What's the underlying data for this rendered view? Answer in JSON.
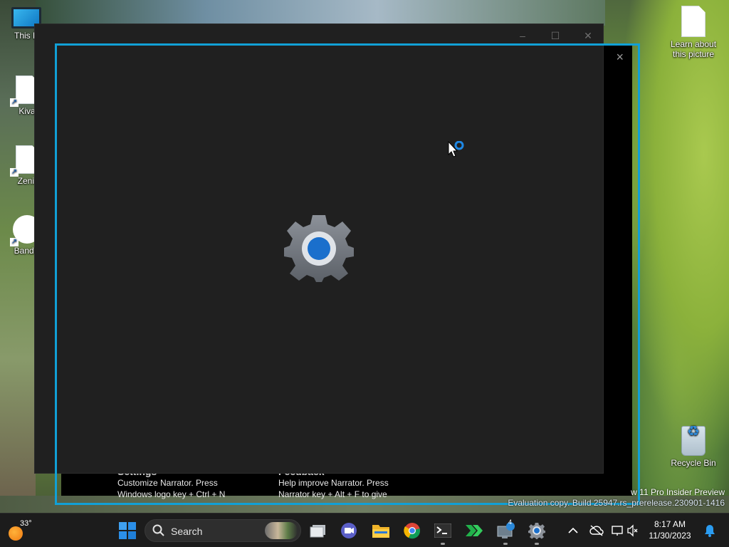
{
  "desktop": {
    "icons": [
      {
        "label": "This P"
      },
      {
        "label": "Kiva"
      },
      {
        "label": "Zenit"
      },
      {
        "label": "Bandic"
      },
      {
        "label": "Learn about this picture"
      },
      {
        "label": "Recycle Bin"
      }
    ]
  },
  "narrator_window": {
    "sections": [
      {
        "title": "Settings",
        "line1": "Customize Narrator. Press",
        "line2": "Windows logo key + Ctrl + N"
      },
      {
        "title": "Feedback",
        "line1": "Help improve Narrator. Press",
        "line2": "Narrator key + Alt + F to give"
      }
    ],
    "close_icon": "×"
  },
  "settings_window": {
    "app_icon": "gear-icon",
    "caption": {
      "minimize": "–",
      "maximize": "☐",
      "close": "✕"
    }
  },
  "watermark": {
    "line1": "w 11 Pro Insider Preview",
    "line2": "Evaluation copy. Build 25947.rs_prerelease.230901-1416"
  },
  "taskbar": {
    "weather_temp": "33°",
    "search_label": "Search",
    "clock_time": "8:17 AM",
    "clock_date": "11/30/2023",
    "badge_count": "4"
  },
  "colors": {
    "highlight": "#11a0d6",
    "window_bg": "#202020",
    "taskbar_bg": "#1c1c1c"
  }
}
